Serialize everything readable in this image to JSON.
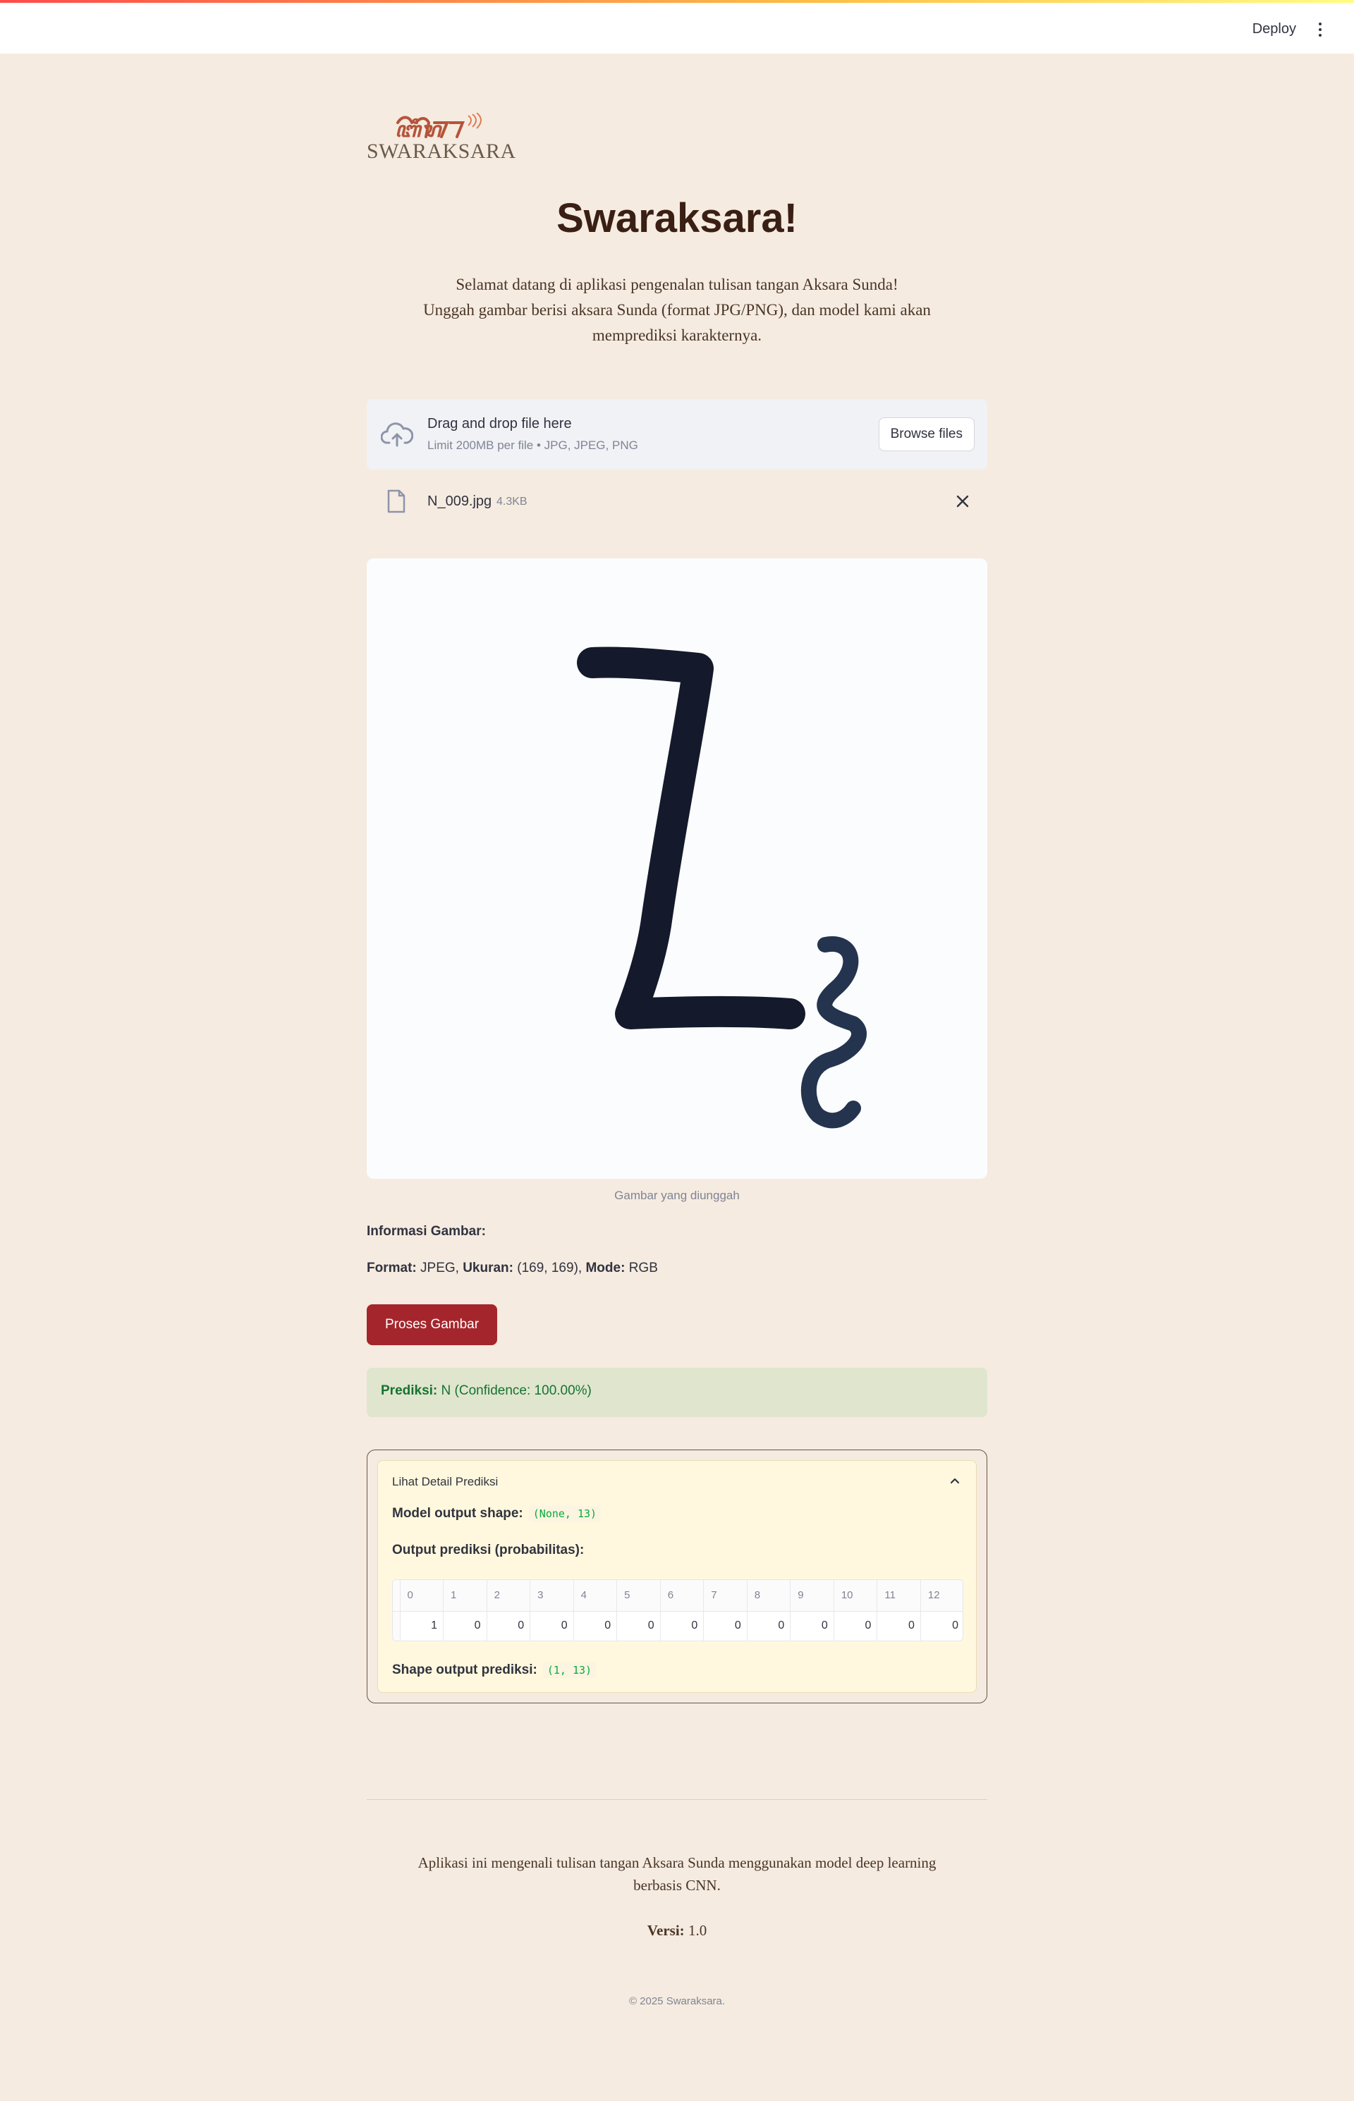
{
  "header": {
    "deploy_label": "Deploy"
  },
  "logo": {
    "script_text": "ᮕᮥᮛᮊ᮪ᮞᮛ",
    "text": "SWARAKSARA"
  },
  "page": {
    "title": "Swaraksara!",
    "intro_line1": "Selamat datang di aplikasi pengenalan tulisan tangan Aksara Sunda!",
    "intro_line2": "Unggah gambar berisi aksara Sunda (format JPG/PNG), dan model kami akan memprediksi karakternya."
  },
  "uploader": {
    "drag_text": "Drag and drop file here",
    "limit_text": "Limit 200MB per file • JPG, JPEG, PNG",
    "browse_label": "Browse files"
  },
  "file": {
    "name": "N_009.jpg",
    "size": "4.3KB"
  },
  "preview": {
    "caption": "Gambar yang diunggah"
  },
  "info": {
    "title": "Informasi Gambar:",
    "format_label": "Format:",
    "format_value": "JPEG",
    "size_label": "Ukuran:",
    "size_value": "(169, 169)",
    "mode_label": "Mode:",
    "mode_value": "RGB"
  },
  "process_button": "Proses Gambar",
  "prediction": {
    "label": "Prediksi:",
    "value": "N (Confidence: 100.00%)"
  },
  "details": {
    "header": "Lihat Detail Prediksi",
    "model_shape_label": "Model output shape:",
    "model_shape_value": "(None, 13)",
    "output_label": "Output prediksi (probabilitas):",
    "columns": [
      "0",
      "1",
      "2",
      "3",
      "4",
      "5",
      "6",
      "7",
      "8",
      "9",
      "10",
      "11",
      "12"
    ],
    "values": [
      "1",
      "0",
      "0",
      "0",
      "0",
      "0",
      "0",
      "0",
      "0",
      "0",
      "0",
      "0",
      "0"
    ],
    "shape_output_label": "Shape output prediksi:",
    "shape_output_value": "(1, 13)"
  },
  "footer": {
    "description": "Aplikasi ini mengenali tulisan tangan Aksara Sunda menggunakan model deep learning berbasis CNN.",
    "version_label": "Versi:",
    "version_value": "1.0",
    "copyright": "© 2025 Swaraksara."
  },
  "colors": {
    "background": "#f5ebe0",
    "accent": "#a4262c",
    "success_bg": "#dfe6cd",
    "success_text": "#177233"
  },
  "icons": [
    "cloud-upload-icon",
    "file-icon",
    "close-icon",
    "chevron-up-icon",
    "kebab-menu-icon"
  ]
}
